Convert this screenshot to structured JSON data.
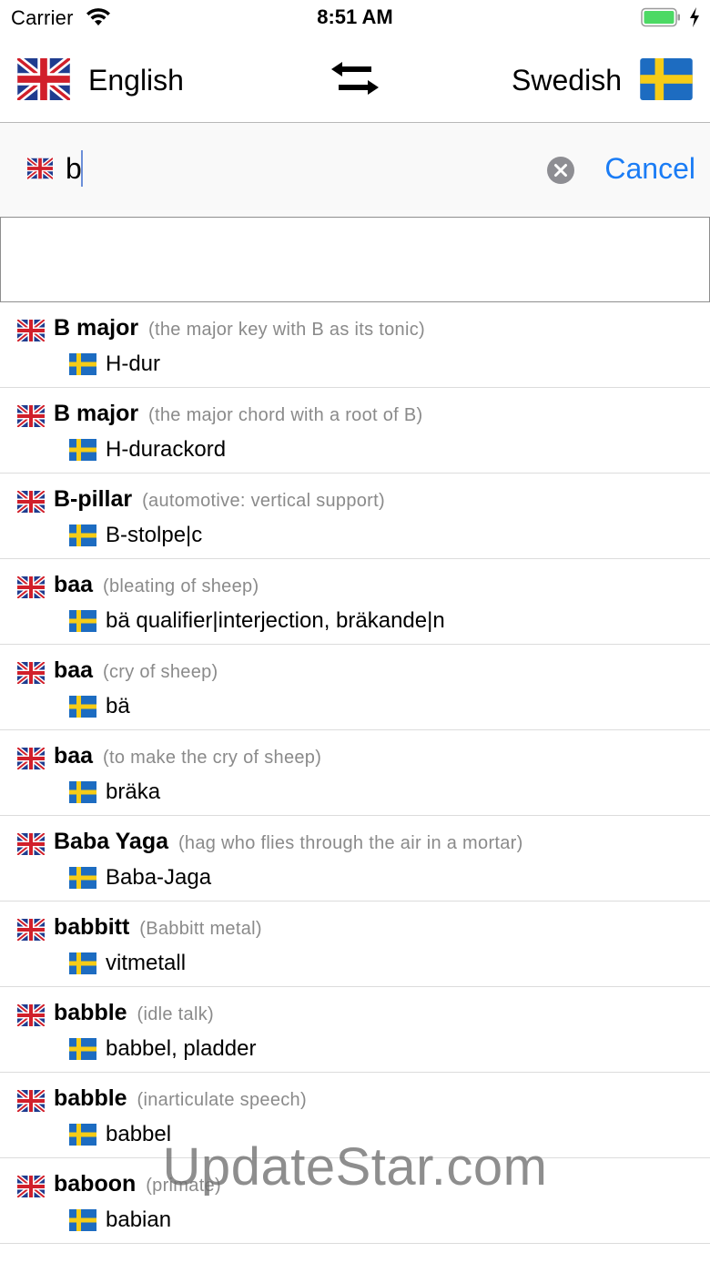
{
  "status_bar": {
    "carrier": "Carrier",
    "time": "8:51 AM",
    "battery_color": "#4cd964"
  },
  "language_bar": {
    "source_language": "English",
    "target_language": "Swedish",
    "source_flag": "uk-flag-icon",
    "target_flag": "sweden-flag-icon",
    "swap_icon": "swap-arrows-icon"
  },
  "search": {
    "value": "b",
    "cancel_label": "Cancel",
    "accent_color": "#1a7cf5"
  },
  "results": [
    {
      "term": "B major",
      "gloss": "(the major key with B as its tonic)",
      "translation": "H-dur"
    },
    {
      "term": "B major",
      "gloss": "(the major chord with a root of B)",
      "translation": "H-durackord"
    },
    {
      "term": "B-pillar",
      "gloss": "(automotive: vertical support)",
      "translation": "B-stolpe|c"
    },
    {
      "term": "baa",
      "gloss": "(bleating of sheep)",
      "translation": "bä qualifier|interjection, bräkande|n"
    },
    {
      "term": "baa",
      "gloss": "(cry of sheep)",
      "translation": "bä"
    },
    {
      "term": "baa",
      "gloss": "(to make the cry of sheep)",
      "translation": "bräka"
    },
    {
      "term": "Baba Yaga",
      "gloss": "(hag who flies through the air in a mortar)",
      "translation": "Baba-Jaga"
    },
    {
      "term": "babbitt",
      "gloss": "(Babbitt metal)",
      "translation": "vitmetall"
    },
    {
      "term": "babble",
      "gloss": "(idle talk)",
      "translation": "babbel, pladder"
    },
    {
      "term": "babble",
      "gloss": "(inarticulate speech)",
      "translation": "babbel"
    },
    {
      "term": "baboon",
      "gloss": "(primate)",
      "translation": "babian"
    }
  ],
  "watermark": "UpdateStar.com"
}
